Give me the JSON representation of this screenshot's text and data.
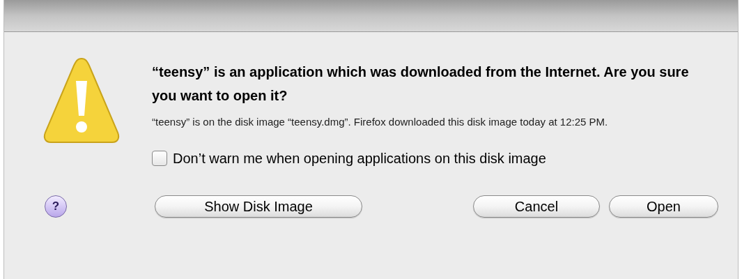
{
  "dialog": {
    "heading": "“teensy” is an application which was downloaded from the Internet. Are you sure you want to open it?",
    "message": "“teensy” is on the disk image “teensy.dmg”. Firefox downloaded this disk image today at 12:25 PM.",
    "checkbox": {
      "label": "Don’t warn me when opening applications on this disk image",
      "checked": false
    },
    "help_button": "?",
    "left_buttons": [
      "Show Disk Image"
    ],
    "right_buttons": [
      "Cancel",
      "Open"
    ]
  }
}
